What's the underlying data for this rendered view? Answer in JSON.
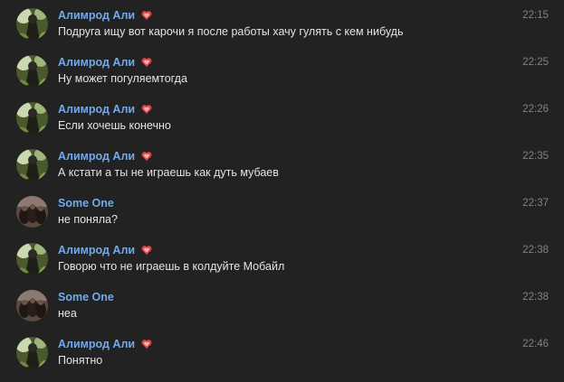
{
  "colors": {
    "background": "#222222",
    "author_name": "#71aaeb",
    "message_text": "#e1e3e6",
    "timestamp": "#828282",
    "badge": "#e64646"
  },
  "badge_icon": "heart-badge-icon",
  "messages": [
    {
      "author": "Алимрод Али",
      "avatar_icon": "avatar-alimrod-icon",
      "time": "22:15",
      "text": "Подруга ищу вот карочи я после работы хачу гулять с кем нибудь",
      "badge": true
    },
    {
      "author": "Алимрод Али",
      "avatar_icon": "avatar-alimrod-icon",
      "time": "22:25",
      "text": "Ну может погуляемтогда",
      "badge": true
    },
    {
      "author": "Алимрод Али",
      "avatar_icon": "avatar-alimrod-icon",
      "time": "22:26",
      "text": "Если хочешь конечно",
      "badge": true
    },
    {
      "author": "Алимрод Али",
      "avatar_icon": "avatar-alimrod-icon",
      "time": "22:35",
      "text": "А кстати а ты не играешь как дуть мубаев",
      "badge": true
    },
    {
      "author": "Some One",
      "avatar_icon": "avatar-someone-icon",
      "time": "22:37",
      "text": "не поняла?",
      "badge": false
    },
    {
      "author": "Алимрод Али",
      "avatar_icon": "avatar-alimrod-icon",
      "time": "22:38",
      "text": "Говорю что не играешь в колдуйте Мобайл",
      "badge": true
    },
    {
      "author": "Some One",
      "avatar_icon": "avatar-someone-icon",
      "time": "22:38",
      "text": "неа",
      "badge": false
    },
    {
      "author": "Алимрод Али",
      "avatar_icon": "avatar-alimrod-icon",
      "time": "22:46",
      "text": "Понятно",
      "badge": true
    }
  ]
}
